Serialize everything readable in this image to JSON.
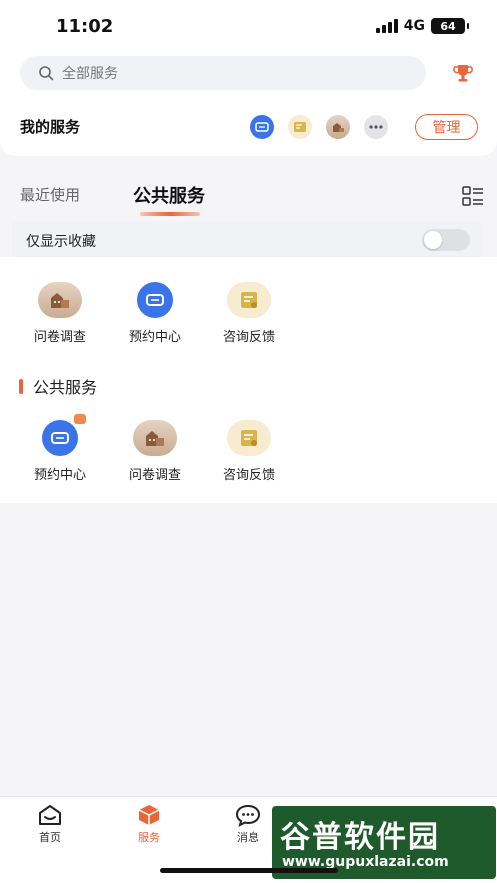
{
  "status": {
    "time": "11:02",
    "network": "4G",
    "battery": "64"
  },
  "search": {
    "placeholder": "全部服务"
  },
  "my_services": {
    "title": "我的服务",
    "manage_label": "管理"
  },
  "tabs": {
    "recent": "最近使用",
    "public": "公共服务"
  },
  "favorites": {
    "label": "仅显示收藏",
    "enabled": false
  },
  "recent_services": [
    {
      "label": "问卷调查",
      "icon": "survey-icon"
    },
    {
      "label": "预约中心",
      "icon": "appointment-icon"
    },
    {
      "label": "咨询反馈",
      "icon": "feedback-icon"
    }
  ],
  "public_section": {
    "title": "公共服务",
    "services": [
      {
        "label": "预约中心",
        "icon": "appointment-icon"
      },
      {
        "label": "问卷调查",
        "icon": "survey-icon"
      },
      {
        "label": "咨询反馈",
        "icon": "feedback-icon"
      }
    ]
  },
  "bottom_nav": [
    {
      "label": "首页",
      "icon": "home-icon"
    },
    {
      "label": "服务",
      "icon": "service-cube-icon",
      "active": true
    },
    {
      "label": "消息",
      "icon": "message-icon"
    }
  ],
  "watermark": {
    "title": "谷普软件园",
    "url": "www.gupuxlazai.com"
  },
  "colors": {
    "accent": "#e8663a",
    "blue": "#3b74e8",
    "gold": "#c9a53a"
  }
}
